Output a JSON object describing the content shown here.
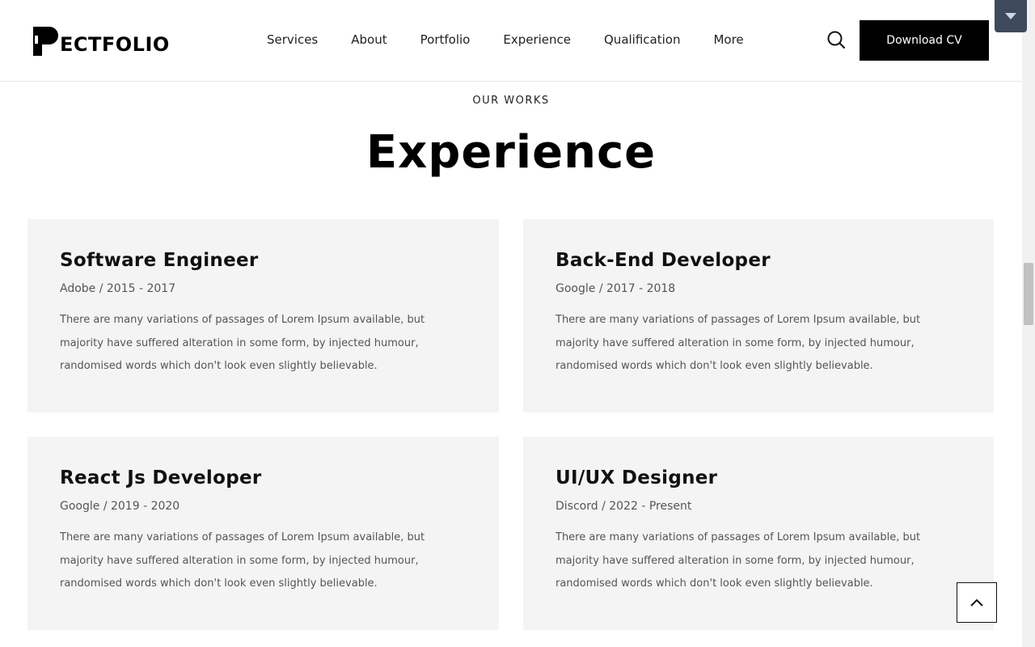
{
  "header": {
    "logo_text": "ECTFOLIO",
    "nav": [
      "Services",
      "About",
      "Portfolio",
      "Experience",
      "Qualification",
      "More"
    ],
    "search_icon": "search-icon",
    "cta_label": "Download CV"
  },
  "section": {
    "eyebrow": "OUR WORKS",
    "title": "Experience"
  },
  "cards": [
    {
      "title": "Software Engineer",
      "meta": "Adobe / 2015 - 2017",
      "desc": "There are many variations of passages of Lorem Ipsum available, but majority have suffered alteration in some form, by injected humour, randomised words which don't look even slightly believable."
    },
    {
      "title": "Back-End Developer",
      "meta": "Google / 2017 - 2018",
      "desc": "There are many variations of passages of Lorem Ipsum available, but majority have suffered alteration in some form, by injected humour, randomised words which don't look even slightly believable."
    },
    {
      "title": "React Js Developer",
      "meta": "Google / 2019 - 2020",
      "desc": "There are many variations of passages of Lorem Ipsum available, but majority have suffered alteration in some form, by injected humour, randomised words which don't look even slightly believable."
    },
    {
      "title": "UI/UX Designer",
      "meta": "Discord / 2022 - Present",
      "desc": "There are many variations of passages of Lorem Ipsum available, but majority have suffered alteration in some form, by injected humour, randomised words which don't look even slightly believable."
    }
  ],
  "icons": {
    "scroll_top": "chevron-up-icon",
    "ext_toggle": "caret-down-icon"
  },
  "colors": {
    "primary": "#000000",
    "card_bg": "#f4f4f4",
    "text_muted": "#555555"
  }
}
